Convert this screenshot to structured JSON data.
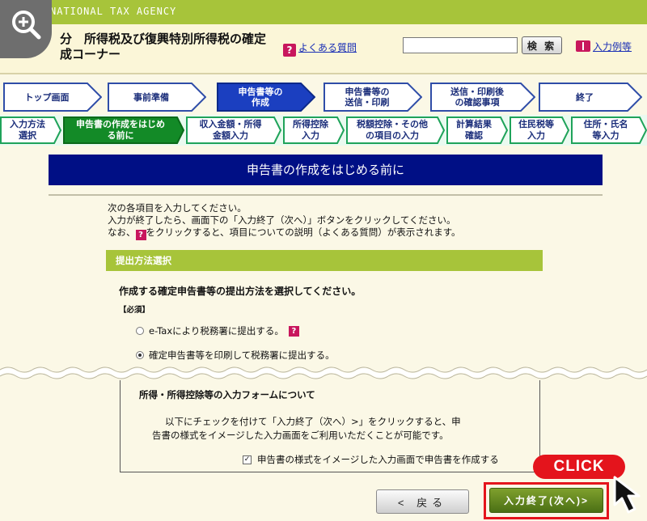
{
  "agency": "NATIONAL TAX AGENCY",
  "header": {
    "title_line1": "分　所得税及び復興特別所得税の確定",
    "title_line2": "成コーナー",
    "faq_label": "よくある質問",
    "search_value": "",
    "search_button": "検 索",
    "example_label": "入力例等"
  },
  "steps": [
    {
      "label": "トップ画面"
    },
    {
      "label": "事前準備"
    },
    {
      "label": "申告書等の\n作成",
      "active": true
    },
    {
      "label": "申告書等の\n送信・印刷"
    },
    {
      "label": "送信・印刷後\nの確認事項"
    },
    {
      "label": "終了"
    }
  ],
  "substeps": [
    {
      "label": "入力方法\n選択"
    },
    {
      "label": "申告書の作成をはじめ\nる前に",
      "active": true
    },
    {
      "label": "収入金額・所得\n金額入力"
    },
    {
      "label": "所得控除\n入力"
    },
    {
      "label": "税額控除・その他\nの項目の入力"
    },
    {
      "label": "計算結果\n確認"
    },
    {
      "label": "住民税等\n入力"
    },
    {
      "label": "住所・氏名\n等入力"
    }
  ],
  "page_heading": "申告書の作成をはじめる前に",
  "instructions": {
    "line1": "次の各項目を入力してください。",
    "line2": "入力が終了したら、画面下の「入力終了（次へ）」ボタンをクリックしてください。",
    "line3_before": "なお、",
    "line3_after": "をクリックすると、項目についての説明（よくある質問）が表示されます。",
    "q_icon": "?"
  },
  "section_title": "提出方法選択",
  "question": "作成する確定申告書等の提出方法を選択してください。",
  "required": "【必須】",
  "options": {
    "etax": "e-Taxにより税務署に提出する。",
    "print": "確定申告書等を印刷して税務署に提出する。",
    "selected": "print"
  },
  "input_form": {
    "title": "所得・所得控除等の入力フォームについて",
    "desc_line1": "以下にチェックを付けて「入力終了（次へ）>」をクリックすると、申",
    "desc_line2": "告書の様式をイメージした入力画面をご利用いただくことが可能です。",
    "checkbox_label": "申告書の様式をイメージした入力画面で申告書を作成する",
    "checkbox_mark": "✓"
  },
  "buttons": {
    "back": "< 戻る",
    "next": "入力終了(次へ)>"
  },
  "annotation": {
    "click": "CLICK"
  },
  "colors": {
    "green": "#a7c43a",
    "navy": "#000f85",
    "step_active": "#1b3fc0",
    "sub_active": "#138a27",
    "highlight": "#e4141c"
  }
}
